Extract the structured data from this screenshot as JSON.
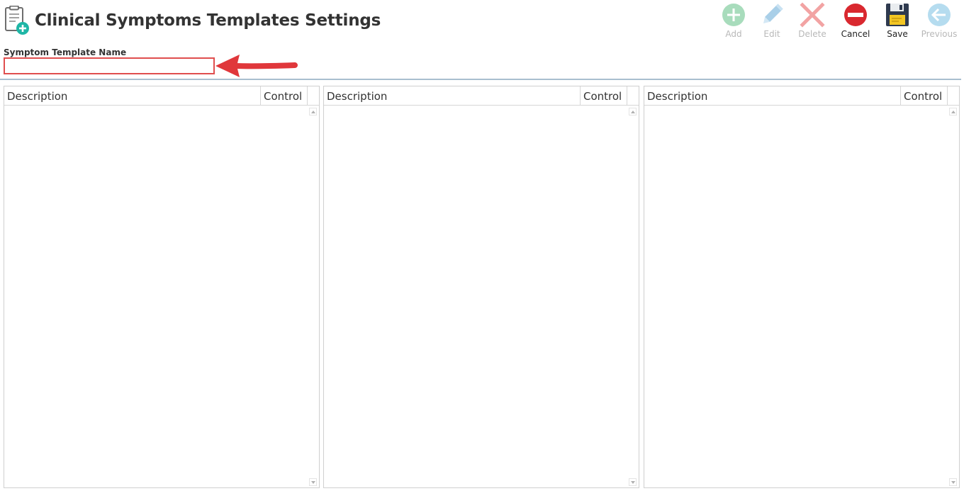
{
  "header": {
    "title": "Clinical Symptoms Templates Settings",
    "icon": "clipboard-add-icon"
  },
  "toolbar": {
    "add": {
      "label": "Add",
      "icon": "plus-circle-icon",
      "enabled": false
    },
    "edit": {
      "label": "Edit",
      "icon": "pencil-icon",
      "enabled": false
    },
    "delete": {
      "label": "Delete",
      "icon": "x-icon",
      "enabled": false
    },
    "cancel": {
      "label": "Cancel",
      "icon": "minus-circle-icon",
      "enabled": true
    },
    "save": {
      "label": "Save",
      "icon": "floppy-disk-icon",
      "enabled": true
    },
    "previous": {
      "label": "Previous",
      "icon": "arrow-left-circle-icon",
      "enabled": false
    }
  },
  "form": {
    "name_label": "Symptom Template Name",
    "name_value": "",
    "name_placeholder": ""
  },
  "grids": [
    {
      "description_header": "Description",
      "control_header": "Control",
      "rows": []
    },
    {
      "description_header": "Description",
      "control_header": "Control",
      "rows": []
    },
    {
      "description_header": "Description",
      "control_header": "Control",
      "rows": []
    }
  ],
  "colors": {
    "highlight_border": "#e04e4e",
    "arrow": "#e0373b",
    "divider": "#a9bfcf",
    "add_icon": "#a8dcbc",
    "edit_icon": "#a9cfe8",
    "delete_icon": "#f2a3a3",
    "cancel_icon": "#d9282f",
    "save_icon": "#2f3a4f",
    "previous_icon": "#b5dcef"
  }
}
